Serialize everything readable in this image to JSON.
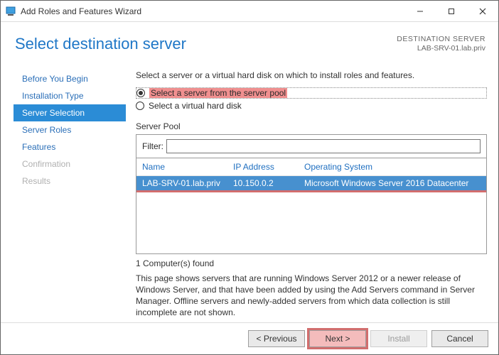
{
  "window": {
    "title": "Add Roles and Features Wizard"
  },
  "header": {
    "page_title": "Select destination server",
    "destination_label": "DESTINATION SERVER",
    "destination_value": "LAB-SRV-01.lab.priv"
  },
  "sidebar": {
    "items": [
      {
        "label": "Before You Begin",
        "state": "normal"
      },
      {
        "label": "Installation Type",
        "state": "normal"
      },
      {
        "label": "Server Selection",
        "state": "selected"
      },
      {
        "label": "Server Roles",
        "state": "normal"
      },
      {
        "label": "Features",
        "state": "normal"
      },
      {
        "label": "Confirmation",
        "state": "disabled"
      },
      {
        "label": "Results",
        "state": "disabled"
      }
    ]
  },
  "main": {
    "intro": "Select a server or a virtual hard disk on which to install roles and features.",
    "radio1": "Select a server from the server pool",
    "radio2": "Select a virtual hard disk",
    "server_pool_label": "Server Pool",
    "filter_label": "Filter:",
    "columns": {
      "name": "Name",
      "ip": "IP Address",
      "os": "Operating System"
    },
    "rows": [
      {
        "name": "LAB-SRV-01.lab.priv",
        "ip": "10.150.0.2",
        "os": "Microsoft Windows Server 2016 Datacenter"
      }
    ],
    "found_text": "1 Computer(s) found",
    "note_text": "This page shows servers that are running Windows Server 2012 or a newer release of Windows Server, and that have been added by using the Add Servers command in Server Manager. Offline servers and newly-added servers from which data collection is still incomplete are not shown."
  },
  "footer": {
    "previous": "< Previous",
    "next": "Next >",
    "install": "Install",
    "cancel": "Cancel"
  }
}
